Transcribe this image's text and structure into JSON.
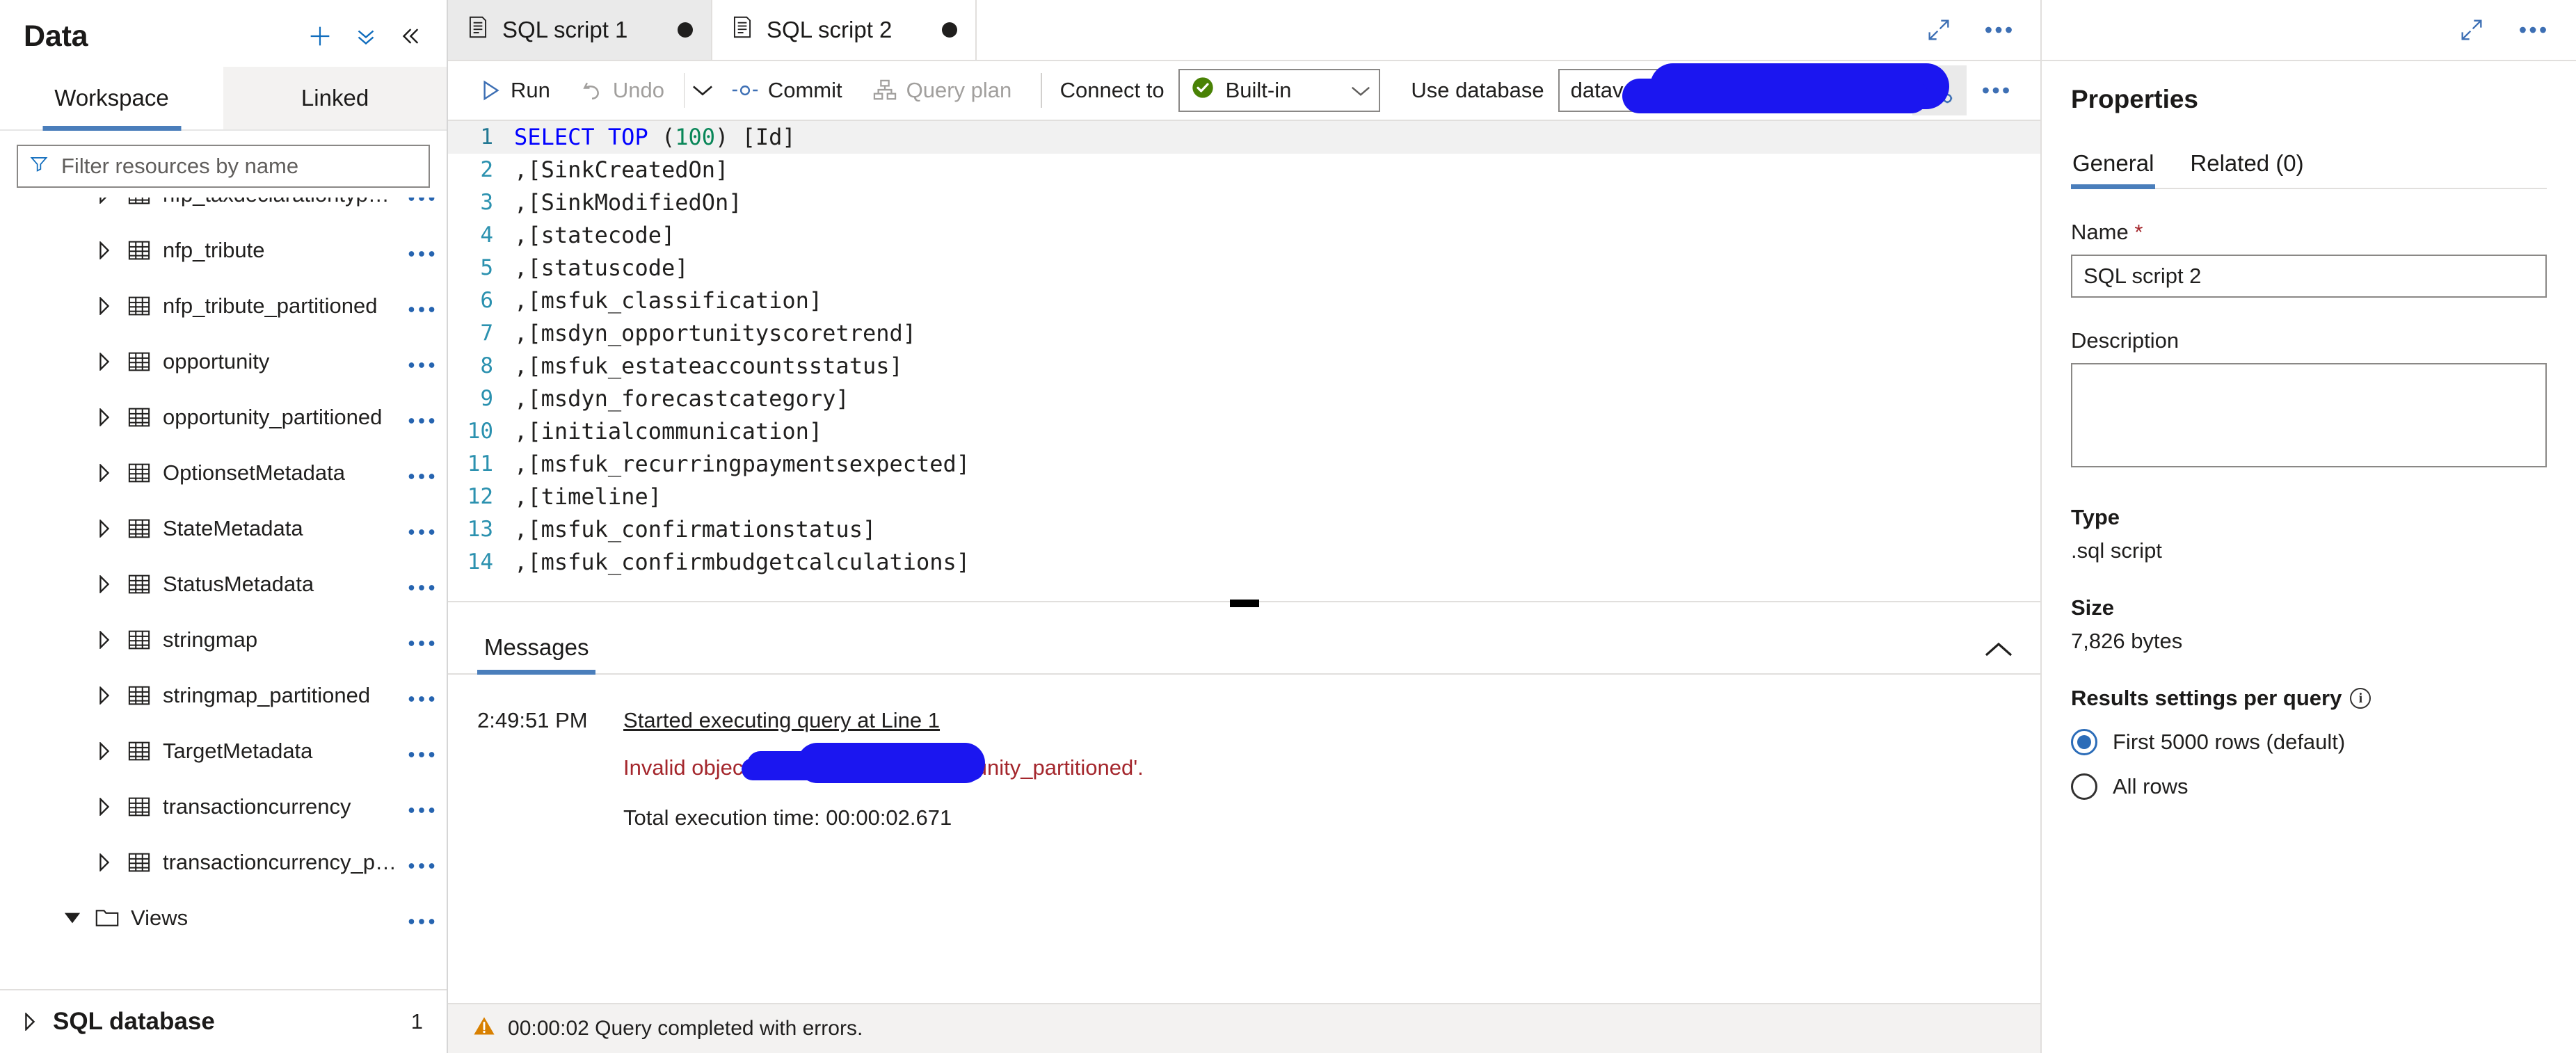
{
  "sidebar": {
    "title": "Data",
    "actions": {
      "add": "add-icon",
      "more_actions": "double-chevron-down-icon",
      "collapse": "double-chevron-left-icon"
    },
    "tabs": [
      {
        "label": "Workspace",
        "active": true
      },
      {
        "label": "Linked",
        "active": false
      }
    ],
    "filter": {
      "placeholder": "Filter resources by name",
      "value": ""
    },
    "tree": [
      {
        "label": "nfp_taxdeclarationtype_...",
        "type": "table",
        "expanded": false,
        "depth": 2
      },
      {
        "label": "nfp_tribute",
        "type": "table",
        "expanded": false,
        "depth": 2
      },
      {
        "label": "nfp_tribute_partitioned",
        "type": "table",
        "expanded": false,
        "depth": 2
      },
      {
        "label": "opportunity",
        "type": "table",
        "expanded": false,
        "depth": 2
      },
      {
        "label": "opportunity_partitioned",
        "type": "table",
        "expanded": false,
        "depth": 2
      },
      {
        "label": "OptionsetMetadata",
        "type": "table",
        "expanded": false,
        "depth": 2
      },
      {
        "label": "StateMetadata",
        "type": "table",
        "expanded": false,
        "depth": 2
      },
      {
        "label": "StatusMetadata",
        "type": "table",
        "expanded": false,
        "depth": 2
      },
      {
        "label": "stringmap",
        "type": "table",
        "expanded": false,
        "depth": 2
      },
      {
        "label": "stringmap_partitioned",
        "type": "table",
        "expanded": false,
        "depth": 2
      },
      {
        "label": "TargetMetadata",
        "type": "table",
        "expanded": false,
        "depth": 2
      },
      {
        "label": "transactioncurrency",
        "type": "table",
        "expanded": false,
        "depth": 2
      },
      {
        "label": "transactioncurrency_part...",
        "type": "table",
        "expanded": false,
        "depth": 2
      },
      {
        "label": "Views",
        "type": "folder",
        "expanded": true,
        "depth": 1
      }
    ],
    "footer": {
      "label": "SQL database",
      "count": "1"
    }
  },
  "tabstrip": {
    "tabs": [
      {
        "label": "SQL script 1",
        "active": false,
        "dirty": true,
        "icon": "sql-script-icon"
      },
      {
        "label": "SQL script 2",
        "active": true,
        "dirty": true,
        "icon": "sql-script-icon"
      }
    ],
    "expand_icon": "expand-diagonal-icon",
    "more_icon": "ellipsis-icon"
  },
  "toolbar": {
    "run_label": "Run",
    "undo_label": "Undo",
    "undo_disabled": true,
    "undo_caret": "chevron-down-icon",
    "commit_label": "Commit",
    "query_plan_label": "Query plan",
    "query_plan_disabled": true,
    "connect_to_label": "Connect to",
    "connect_to_value": "Built-in",
    "connect_to_status": "connected-check-icon",
    "use_database_label": "Use database",
    "use_database_value": "dataverse_",
    "refresh_icon": "refresh-icon",
    "results_settings_icon": "results-settings-icon",
    "more_icon": "ellipsis-icon"
  },
  "editor": {
    "lines": [
      {
        "n": "1",
        "text": "SELECT TOP (100) [Id]",
        "current": true
      },
      {
        "n": "2",
        "text": ",[SinkCreatedOn]",
        "current": false
      },
      {
        "n": "3",
        "text": ",[SinkModifiedOn]",
        "current": false
      },
      {
        "n": "4",
        "text": ",[statecode]",
        "current": false
      },
      {
        "n": "5",
        "text": ",[statuscode]",
        "current": false
      },
      {
        "n": "6",
        "text": ",[msfuk_classification]",
        "current": false
      },
      {
        "n": "7",
        "text": ",[msdyn_opportunityscoretrend]",
        "current": false
      },
      {
        "n": "8",
        "text": ",[msfuk_estateaccountsstatus]",
        "current": false
      },
      {
        "n": "9",
        "text": ",[msdyn_forecastcategory]",
        "current": false
      },
      {
        "n": "10",
        "text": ",[initialcommunication]",
        "current": false
      },
      {
        "n": "11",
        "text": ",[msfuk_recurringpaymentsexpected]",
        "current": false
      },
      {
        "n": "12",
        "text": ",[timeline]",
        "current": false
      },
      {
        "n": "13",
        "text": ",[msfuk_confirmationstatus]",
        "current": false
      },
      {
        "n": "14",
        "text": ",[msfuk_confirmbudgetcalculations]",
        "current": false
      }
    ],
    "line1_tokens": {
      "kw1": "SELECT",
      "kw2": "TOP",
      "paren_open": " (",
      "number": "100",
      "rest": ") [Id]"
    }
  },
  "results": {
    "tabs": [
      {
        "label": "Messages",
        "active": true
      }
    ],
    "collapse_icon": "chevron-up-icon",
    "messages": [
      {
        "time": "2:49:51 PM",
        "text": "Started executing query at Line 1",
        "style": "link"
      },
      {
        "time": "",
        "text": "Invalid object name 'datav",
        "text_tail": "dbo.opportunity_partitioned'.",
        "style": "error"
      },
      {
        "time": "",
        "text": "Total execution time: 00:00:02.671",
        "style": "plain"
      }
    ]
  },
  "statusbar": {
    "icon": "warning-icon",
    "text": "00:00:02 Query completed with errors."
  },
  "properties": {
    "title": "Properties",
    "topbar": {
      "expand_icon": "expand-diagonal-icon",
      "more_icon": "ellipsis-icon"
    },
    "tabs": [
      {
        "label": "General",
        "active": true
      },
      {
        "label": "Related (0)",
        "active": false
      }
    ],
    "name_label": "Name",
    "name_required": "*",
    "name_value": "SQL script 2",
    "description_label": "Description",
    "description_value": "",
    "type_label": "Type",
    "type_value": ".sql script",
    "size_label": "Size",
    "size_value": "7,826 bytes",
    "results_settings_label": "Results settings per query",
    "results_settings_info": "info-icon",
    "results_options": [
      {
        "label": "First 5000 rows (default)",
        "selected": true
      },
      {
        "label": "All rows",
        "selected": false
      }
    ]
  },
  "colors": {
    "accent": "#4a7ebb",
    "link": "#0f6cbd",
    "error": "#a4262c",
    "warning": "#d83b01",
    "success": "#498205",
    "redaction": "#1b16f0"
  }
}
